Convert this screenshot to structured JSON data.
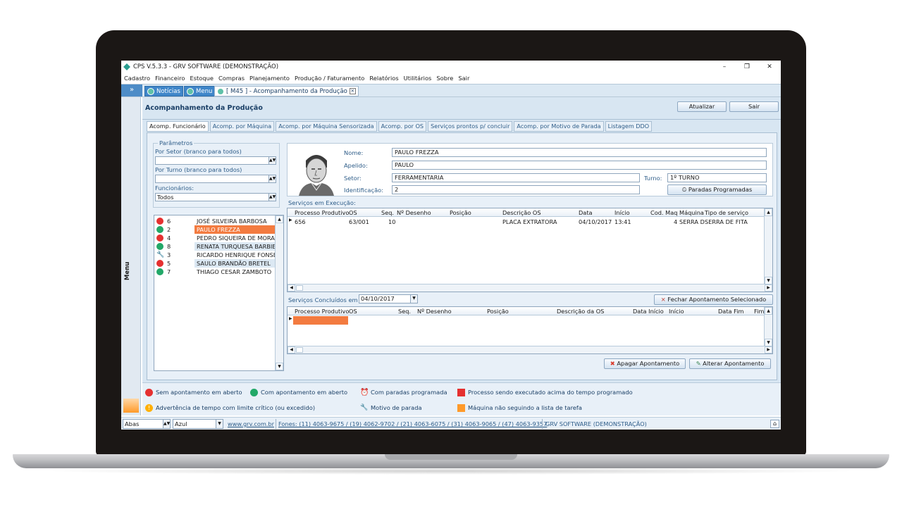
{
  "window": {
    "title": "CPS V.5.3.3 - GRV SOFTWARE (DEMONSTRAÇÃO)",
    "minimize": "–",
    "restore": "❐",
    "close": "✕"
  },
  "menu": [
    "Cadastro",
    "Financeiro",
    "Estoque",
    "Compras",
    "Planejamento",
    "Produção / Faturamento",
    "Relatórios",
    "Utilitários",
    "Sobre",
    "Sair"
  ],
  "tabstrip": {
    "expand": "»",
    "tabs": [
      "Notícias",
      "Menu",
      "[ M45 ] - Acompanhamento da Produção"
    ],
    "close": "×"
  },
  "sidebar": {
    "label": "Menu"
  },
  "page": {
    "title": "Acompanhamento da Produção",
    "btn_update": "Atualizar",
    "btn_exit": "Sair"
  },
  "subtabs": [
    "Acomp. Funcionário",
    "Acomp. por Máquina",
    "Acomp. por Máquina Sensorizada",
    "Acomp. por OS",
    "Serviços prontos p/ concluir",
    "Acomp. por Motivo de Parada",
    "Listagem DDO"
  ],
  "params": {
    "legend": "Parâmetros",
    "sector_label": "Por Setor (branco para todos)",
    "sector_value": "",
    "shift_label": "Por Turno (branco para todos)",
    "shift_value": "",
    "employees_label": "Funcionários:",
    "employees_value": "Todos"
  },
  "employees": [
    {
      "num": "6",
      "name": "JOSÉ SILVEIRA BARBOSA",
      "status": "red"
    },
    {
      "num": "2",
      "name": "PAULO FREZZA",
      "status": "green",
      "selected": true
    },
    {
      "num": "4",
      "name": "PEDRO SIQUEIRA DE MORAES",
      "status": "red"
    },
    {
      "num": "8",
      "name": "RENATA TURQUESA BARBIERI",
      "status": "green"
    },
    {
      "num": "3",
      "name": "RICARDO HENRIQUE FONSECA",
      "status": "wrench"
    },
    {
      "num": "5",
      "name": "SAULO BRANDÃO BRETEL",
      "status": "red"
    },
    {
      "num": "7",
      "name": "THIAGO CESAR ZAMBOTO",
      "status": "green"
    }
  ],
  "info": {
    "name_label": "Nome:",
    "name": "PAULO FREZZA",
    "nick_label": "Apelido:",
    "nick": "PAULO",
    "sector_label": "Setor:",
    "sector": "FERRAMENTARIA",
    "shift_label": "Turno:",
    "shift": "1º TURNO",
    "id_label": "Identificação:",
    "id": "2",
    "btn_stops": "Paradas Programadas"
  },
  "running": {
    "label": "Serviços em Execução:",
    "headers": [
      "Processo Produtivo",
      "OS",
      "Seq.",
      "Nº Desenho",
      "Posição",
      "Descrição OS",
      "Data",
      "Início",
      "Cod. Maq",
      "Máquina",
      "Tipo de serviço"
    ],
    "rows": [
      {
        "processo": "656",
        "os": "63/001",
        "seq": "10",
        "desenho": "",
        "posicao": "",
        "descricao": "PLACA EXTRATORA",
        "data": "04/10/2017",
        "inicio": "13:41",
        "codmaq": "4",
        "maquina": "SERRA DE",
        "tipo": "SERRA DE FITA"
      }
    ]
  },
  "done": {
    "label": "Serviços Concluídos em",
    "date": "04/10/2017",
    "btn_close": "Fechar Apontamento Selecionado",
    "headers": [
      "Processo Produtivo",
      "OS",
      "Seq.",
      "Nº Desenho",
      "Posição",
      "Descrição da OS",
      "Data Início",
      "Início",
      "Data Fim",
      "Fim"
    ]
  },
  "actions": {
    "delete": "Apagar Apontamento",
    "edit": "Alterar Apontamento"
  },
  "legend": {
    "no_open": "Sem apontamento em aberto",
    "open": "Com apontamento em aberto",
    "scheduled": "Com paradas programada",
    "over_time": "Processo sendo executado acima do tempo programado",
    "warning": "Advertência de tempo com limite crítico (ou excedido)",
    "stop_reason": "Motivo de parada",
    "not_following": "Máquina não seguindo a lista de tarefa"
  },
  "status": {
    "mode": "Abas",
    "theme": "Azul",
    "site": "www.grv.com.br",
    "phones": "Fones: (11) 4063-9675 / (19) 4062-9702 / (21) 4063-6075 / (31) 4063-9065 / (47) 4063-9357",
    "company": "GRV SOFTWARE (DEMONSTRAÇÃO)"
  },
  "colors": {
    "red": "#e53030",
    "green": "#22a868",
    "orange_sel": "#f37b40",
    "accent": "#3f86c9",
    "amber": "#ff9a2a"
  }
}
